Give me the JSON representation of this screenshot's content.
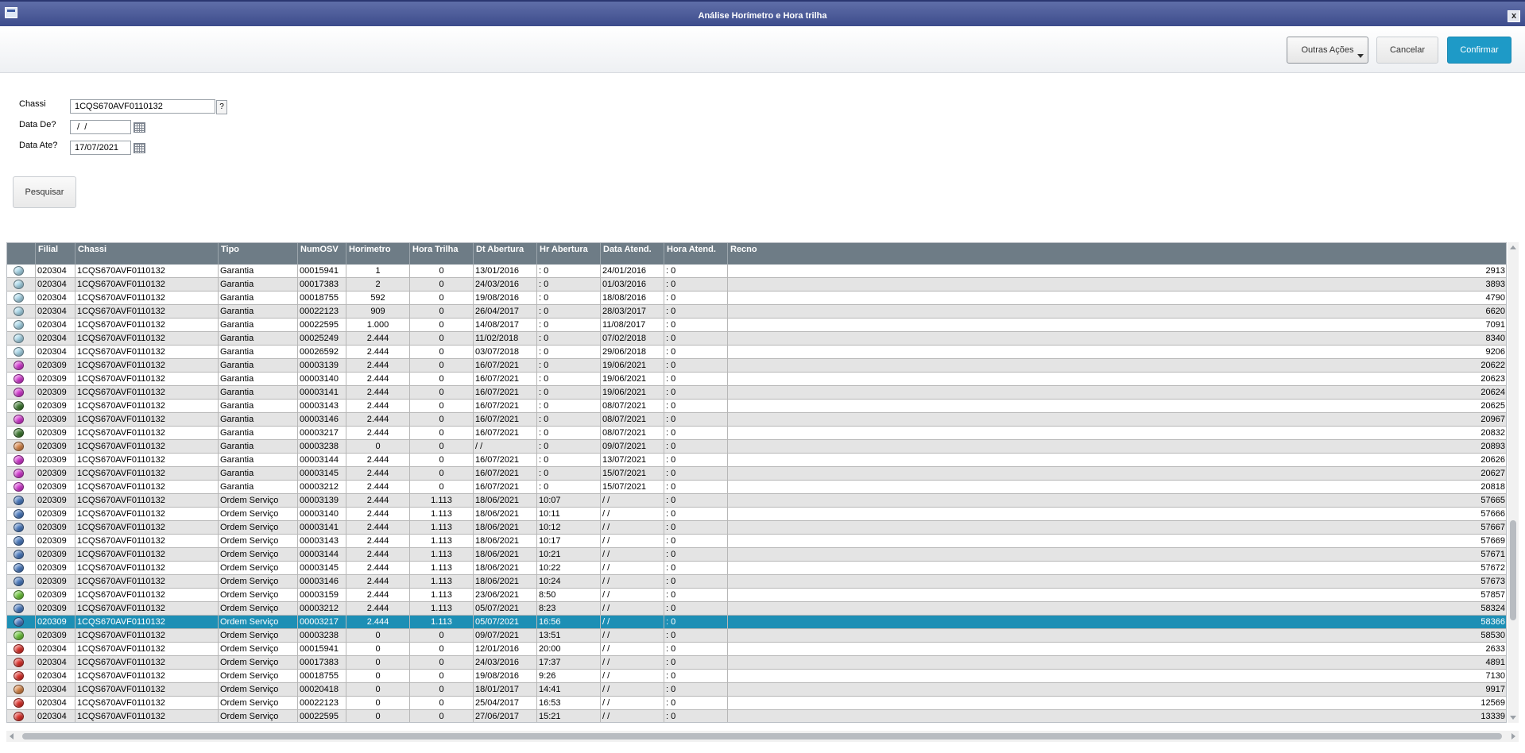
{
  "window": {
    "title": "Análise Horímetro e Hora trilha",
    "close_label": "x"
  },
  "toolbar": {
    "other_actions_label": "Outras Ações",
    "cancel_label": "Cancelar",
    "confirm_label": "Confirmar"
  },
  "form": {
    "chassi_label": "Chassi",
    "chassi_value": "1CQS670AVF0110132",
    "help_label": "?",
    "date_from_label": "Data De?",
    "date_from_value": " /  /",
    "date_to_label": "Data Ate?",
    "date_to_value": "17/07/2021",
    "search_label": "Pesquisar"
  },
  "colors": {
    "accent": "#1e9ac7",
    "selected_row": "#1d8fb5",
    "header": "#6e7c86"
  },
  "status_colors": {
    "light-blue": "#a9d8ea",
    "magenta": "#d63bd3",
    "dark-green": "#3f7a32",
    "orange": "#d9874a",
    "blue": "#4c7cc1",
    "green": "#6ec63c",
    "red": "#e0332d"
  },
  "table": {
    "columns": [
      "",
      "Filial",
      "Chassi",
      "Tipo",
      "NumOSV",
      "Horimetro",
      "Hora Trilha",
      "Dt Abertura",
      "Hr Abertura",
      "Data Atend.",
      "Hora Atend.",
      "Recno"
    ],
    "rows": [
      {
        "status": "light-blue",
        "filial": "020304",
        "chassi": "1CQS670AVF0110132",
        "tipo": "Garantia",
        "numosv": "00015941",
        "horimetro": "1",
        "hora_trilha": "0",
        "dt_abertura": "13/01/2016",
        "hr_abertura": ": 0",
        "data_atend": "24/01/2016",
        "hora_atend": ": 0",
        "recno": "2913"
      },
      {
        "status": "light-blue",
        "filial": "020304",
        "chassi": "1CQS670AVF0110132",
        "tipo": "Garantia",
        "numosv": "00017383",
        "horimetro": "2",
        "hora_trilha": "0",
        "dt_abertura": "24/03/2016",
        "hr_abertura": ": 0",
        "data_atend": "01/03/2016",
        "hora_atend": ": 0",
        "recno": "3893"
      },
      {
        "status": "light-blue",
        "filial": "020304",
        "chassi": "1CQS670AVF0110132",
        "tipo": "Garantia",
        "numosv": "00018755",
        "horimetro": "592",
        "hora_trilha": "0",
        "dt_abertura": "19/08/2016",
        "hr_abertura": ": 0",
        "data_atend": "18/08/2016",
        "hora_atend": ": 0",
        "recno": "4790"
      },
      {
        "status": "light-blue",
        "filial": "020304",
        "chassi": "1CQS670AVF0110132",
        "tipo": "Garantia",
        "numosv": "00022123",
        "horimetro": "909",
        "hora_trilha": "0",
        "dt_abertura": "26/04/2017",
        "hr_abertura": ": 0",
        "data_atend": "28/03/2017",
        "hora_atend": ": 0",
        "recno": "6620"
      },
      {
        "status": "light-blue",
        "filial": "020304",
        "chassi": "1CQS670AVF0110132",
        "tipo": "Garantia",
        "numosv": "00022595",
        "horimetro": "1.000",
        "hora_trilha": "0",
        "dt_abertura": "14/08/2017",
        "hr_abertura": ": 0",
        "data_atend": "11/08/2017",
        "hora_atend": ": 0",
        "recno": "7091"
      },
      {
        "status": "light-blue",
        "filial": "020304",
        "chassi": "1CQS670AVF0110132",
        "tipo": "Garantia",
        "numosv": "00025249",
        "horimetro": "2.444",
        "hora_trilha": "0",
        "dt_abertura": "11/02/2018",
        "hr_abertura": ": 0",
        "data_atend": "07/02/2018",
        "hora_atend": ": 0",
        "recno": "8340"
      },
      {
        "status": "light-blue",
        "filial": "020304",
        "chassi": "1CQS670AVF0110132",
        "tipo": "Garantia",
        "numosv": "00026592",
        "horimetro": "2.444",
        "hora_trilha": "0",
        "dt_abertura": "03/07/2018",
        "hr_abertura": ": 0",
        "data_atend": "29/06/2018",
        "hora_atend": ": 0",
        "recno": "9206"
      },
      {
        "status": "magenta",
        "filial": "020309",
        "chassi": "1CQS670AVF0110132",
        "tipo": "Garantia",
        "numosv": "00003139",
        "horimetro": "2.444",
        "hora_trilha": "0",
        "dt_abertura": "16/07/2021",
        "hr_abertura": ": 0",
        "data_atend": "19/06/2021",
        "hora_atend": ": 0",
        "recno": "20622"
      },
      {
        "status": "magenta",
        "filial": "020309",
        "chassi": "1CQS670AVF0110132",
        "tipo": "Garantia",
        "numosv": "00003140",
        "horimetro": "2.444",
        "hora_trilha": "0",
        "dt_abertura": "16/07/2021",
        "hr_abertura": ": 0",
        "data_atend": "19/06/2021",
        "hora_atend": ": 0",
        "recno": "20623"
      },
      {
        "status": "magenta",
        "filial": "020309",
        "chassi": "1CQS670AVF0110132",
        "tipo": "Garantia",
        "numosv": "00003141",
        "horimetro": "2.444",
        "hora_trilha": "0",
        "dt_abertura": "16/07/2021",
        "hr_abertura": ": 0",
        "data_atend": "19/06/2021",
        "hora_atend": ": 0",
        "recno": "20624"
      },
      {
        "status": "dark-green",
        "filial": "020309",
        "chassi": "1CQS670AVF0110132",
        "tipo": "Garantia",
        "numosv": "00003143",
        "horimetro": "2.444",
        "hora_trilha": "0",
        "dt_abertura": "16/07/2021",
        "hr_abertura": ": 0",
        "data_atend": "08/07/2021",
        "hora_atend": ": 0",
        "recno": "20625"
      },
      {
        "status": "magenta",
        "filial": "020309",
        "chassi": "1CQS670AVF0110132",
        "tipo": "Garantia",
        "numosv": "00003146",
        "horimetro": "2.444",
        "hora_trilha": "0",
        "dt_abertura": "16/07/2021",
        "hr_abertura": ": 0",
        "data_atend": "08/07/2021",
        "hora_atend": ": 0",
        "recno": "20967"
      },
      {
        "status": "dark-green",
        "filial": "020309",
        "chassi": "1CQS670AVF0110132",
        "tipo": "Garantia",
        "numosv": "00003217",
        "horimetro": "2.444",
        "hora_trilha": "0",
        "dt_abertura": "16/07/2021",
        "hr_abertura": ": 0",
        "data_atend": "08/07/2021",
        "hora_atend": ": 0",
        "recno": "20832"
      },
      {
        "status": "orange",
        "filial": "020309",
        "chassi": "1CQS670AVF0110132",
        "tipo": "Garantia",
        "numosv": "00003238",
        "horimetro": "0",
        "hora_trilha": "0",
        "dt_abertura": " /  /",
        "hr_abertura": ": 0",
        "data_atend": "09/07/2021",
        "hora_atend": ": 0",
        "recno": "20893"
      },
      {
        "status": "magenta",
        "filial": "020309",
        "chassi": "1CQS670AVF0110132",
        "tipo": "Garantia",
        "numosv": "00003144",
        "horimetro": "2.444",
        "hora_trilha": "0",
        "dt_abertura": "16/07/2021",
        "hr_abertura": ": 0",
        "data_atend": "13/07/2021",
        "hora_atend": ": 0",
        "recno": "20626"
      },
      {
        "status": "magenta",
        "filial": "020309",
        "chassi": "1CQS670AVF0110132",
        "tipo": "Garantia",
        "numosv": "00003145",
        "horimetro": "2.444",
        "hora_trilha": "0",
        "dt_abertura": "16/07/2021",
        "hr_abertura": ": 0",
        "data_atend": "15/07/2021",
        "hora_atend": ": 0",
        "recno": "20627"
      },
      {
        "status": "magenta",
        "filial": "020309",
        "chassi": "1CQS670AVF0110132",
        "tipo": "Garantia",
        "numosv": "00003212",
        "horimetro": "2.444",
        "hora_trilha": "0",
        "dt_abertura": "16/07/2021",
        "hr_abertura": ": 0",
        "data_atend": "15/07/2021",
        "hora_atend": ": 0",
        "recno": "20818"
      },
      {
        "status": "blue",
        "filial": "020309",
        "chassi": "1CQS670AVF0110132",
        "tipo": "Ordem Serviço",
        "numosv": "00003139",
        "horimetro": "2.444",
        "hora_trilha": "1.113",
        "dt_abertura": "18/06/2021",
        "hr_abertura": "10:07",
        "data_atend": " /  /",
        "hora_atend": ": 0",
        "recno": "57665"
      },
      {
        "status": "blue",
        "filial": "020309",
        "chassi": "1CQS670AVF0110132",
        "tipo": "Ordem Serviço",
        "numosv": "00003140",
        "horimetro": "2.444",
        "hora_trilha": "1.113",
        "dt_abertura": "18/06/2021",
        "hr_abertura": "10:11",
        "data_atend": " /  /",
        "hora_atend": ": 0",
        "recno": "57666"
      },
      {
        "status": "blue",
        "filial": "020309",
        "chassi": "1CQS670AVF0110132",
        "tipo": "Ordem Serviço",
        "numosv": "00003141",
        "horimetro": "2.444",
        "hora_trilha": "1.113",
        "dt_abertura": "18/06/2021",
        "hr_abertura": "10:12",
        "data_atend": " /  /",
        "hora_atend": ": 0",
        "recno": "57667"
      },
      {
        "status": "blue",
        "filial": "020309",
        "chassi": "1CQS670AVF0110132",
        "tipo": "Ordem Serviço",
        "numosv": "00003143",
        "horimetro": "2.444",
        "hora_trilha": "1.113",
        "dt_abertura": "18/06/2021",
        "hr_abertura": "10:17",
        "data_atend": " /  /",
        "hora_atend": ": 0",
        "recno": "57669"
      },
      {
        "status": "blue",
        "filial": "020309",
        "chassi": "1CQS670AVF0110132",
        "tipo": "Ordem Serviço",
        "numosv": "00003144",
        "horimetro": "2.444",
        "hora_trilha": "1.113",
        "dt_abertura": "18/06/2021",
        "hr_abertura": "10:21",
        "data_atend": " /  /",
        "hora_atend": ": 0",
        "recno": "57671"
      },
      {
        "status": "blue",
        "filial": "020309",
        "chassi": "1CQS670AVF0110132",
        "tipo": "Ordem Serviço",
        "numosv": "00003145",
        "horimetro": "2.444",
        "hora_trilha": "1.113",
        "dt_abertura": "18/06/2021",
        "hr_abertura": "10:22",
        "data_atend": " /  /",
        "hora_atend": ": 0",
        "recno": "57672"
      },
      {
        "status": "blue",
        "filial": "020309",
        "chassi": "1CQS670AVF0110132",
        "tipo": "Ordem Serviço",
        "numosv": "00003146",
        "horimetro": "2.444",
        "hora_trilha": "1.113",
        "dt_abertura": "18/06/2021",
        "hr_abertura": "10:24",
        "data_atend": " /  /",
        "hora_atend": ": 0",
        "recno": "57673"
      },
      {
        "status": "green",
        "filial": "020309",
        "chassi": "1CQS670AVF0110132",
        "tipo": "Ordem Serviço",
        "numosv": "00003159",
        "horimetro": "2.444",
        "hora_trilha": "1.113",
        "dt_abertura": "23/06/2021",
        "hr_abertura": "8:50",
        "data_atend": " /  /",
        "hora_atend": ": 0",
        "recno": "57857"
      },
      {
        "status": "blue",
        "filial": "020309",
        "chassi": "1CQS670AVF0110132",
        "tipo": "Ordem Serviço",
        "numosv": "00003212",
        "horimetro": "2.444",
        "hora_trilha": "1.113",
        "dt_abertura": "05/07/2021",
        "hr_abertura": "8:23",
        "data_atend": " /  /",
        "hora_atend": ": 0",
        "recno": "58324"
      },
      {
        "status": "blue",
        "filial": "020309",
        "chassi": "1CQS670AVF0110132",
        "tipo": "Ordem Serviço",
        "numosv": "00003217",
        "horimetro": "2.444",
        "hora_trilha": "1.113",
        "dt_abertura": "05/07/2021",
        "hr_abertura": "16:56",
        "data_atend": " /  /",
        "hora_atend": ": 0",
        "recno": "58366",
        "selected": true
      },
      {
        "status": "green",
        "filial": "020309",
        "chassi": "1CQS670AVF0110132",
        "tipo": "Ordem Serviço",
        "numosv": "00003238",
        "horimetro": "0",
        "hora_trilha": "0",
        "dt_abertura": "09/07/2021",
        "hr_abertura": "13:51",
        "data_atend": " /  /",
        "hora_atend": ": 0",
        "recno": "58530"
      },
      {
        "status": "red",
        "filial": "020304",
        "chassi": "1CQS670AVF0110132",
        "tipo": "Ordem Serviço",
        "numosv": "00015941",
        "horimetro": "0",
        "hora_trilha": "0",
        "dt_abertura": "12/01/2016",
        "hr_abertura": "20:00",
        "data_atend": " /  /",
        "hora_atend": ": 0",
        "recno": "2633"
      },
      {
        "status": "red",
        "filial": "020304",
        "chassi": "1CQS670AVF0110132",
        "tipo": "Ordem Serviço",
        "numosv": "00017383",
        "horimetro": "0",
        "hora_trilha": "0",
        "dt_abertura": "24/03/2016",
        "hr_abertura": "17:37",
        "data_atend": " /  /",
        "hora_atend": ": 0",
        "recno": "4891"
      },
      {
        "status": "red",
        "filial": "020304",
        "chassi": "1CQS670AVF0110132",
        "tipo": "Ordem Serviço",
        "numosv": "00018755",
        "horimetro": "0",
        "hora_trilha": "0",
        "dt_abertura": "19/08/2016",
        "hr_abertura": "9:26",
        "data_atend": " /  /",
        "hora_atend": ": 0",
        "recno": "7130"
      },
      {
        "status": "orange",
        "filial": "020304",
        "chassi": "1CQS670AVF0110132",
        "tipo": "Ordem Serviço",
        "numosv": "00020418",
        "horimetro": "0",
        "hora_trilha": "0",
        "dt_abertura": "18/01/2017",
        "hr_abertura": "14:41",
        "data_atend": " /  /",
        "hora_atend": ": 0",
        "recno": "9917"
      },
      {
        "status": "red",
        "filial": "020304",
        "chassi": "1CQS670AVF0110132",
        "tipo": "Ordem Serviço",
        "numosv": "00022123",
        "horimetro": "0",
        "hora_trilha": "0",
        "dt_abertura": "25/04/2017",
        "hr_abertura": "16:53",
        "data_atend": " /  /",
        "hora_atend": ": 0",
        "recno": "12569"
      },
      {
        "status": "red",
        "filial": "020304",
        "chassi": "1CQS670AVF0110132",
        "tipo": "Ordem Serviço",
        "numosv": "00022595",
        "horimetro": "0",
        "hora_trilha": "0",
        "dt_abertura": "27/06/2017",
        "hr_abertura": "15:21",
        "data_atend": " /  /",
        "hora_atend": ": 0",
        "recno": "13339"
      }
    ]
  }
}
